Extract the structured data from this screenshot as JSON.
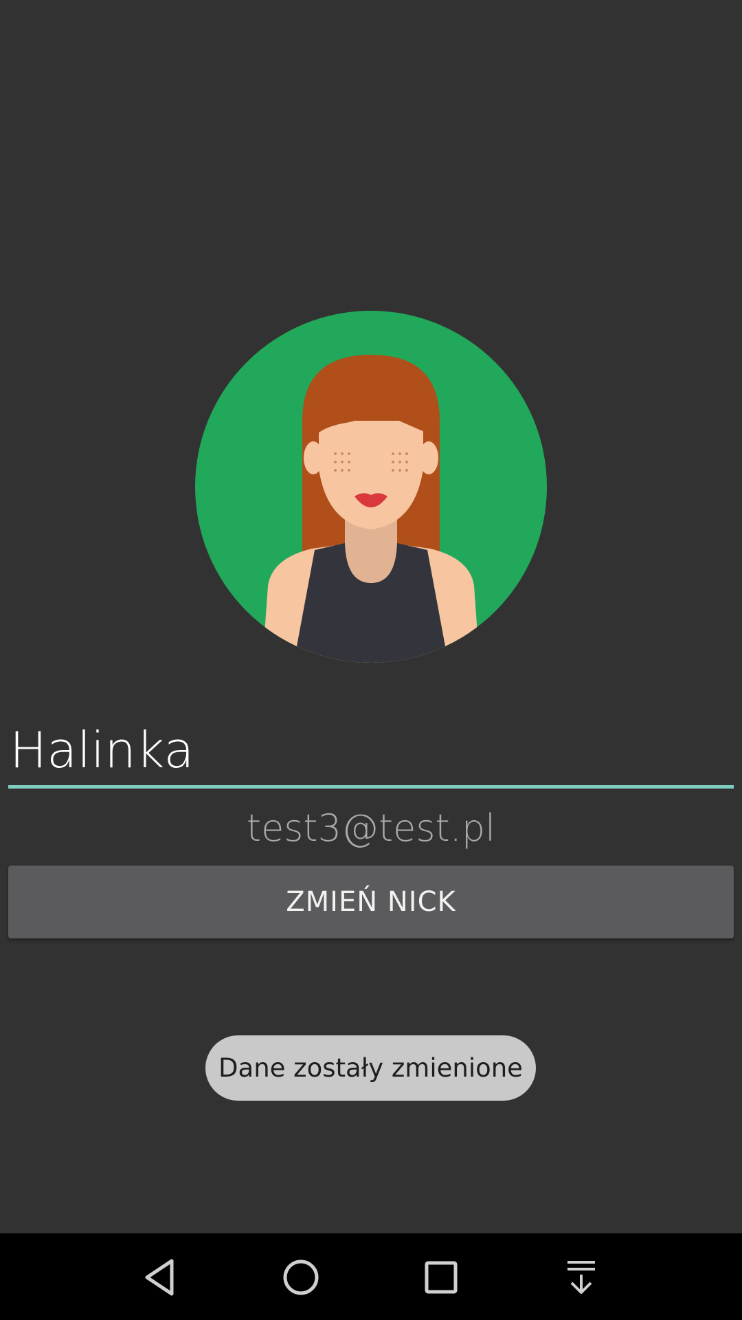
{
  "profile": {
    "avatar_icon": "female-avatar-icon",
    "nick": "Halinka",
    "email": "test3@test.pl"
  },
  "actions": {
    "change_nick_label": "ZMIEŃ NICK"
  },
  "toast": {
    "message": "Dane zostały zmienione"
  },
  "navbar": {
    "back_icon": "back-triangle-icon",
    "home_icon": "home-circle-icon",
    "recents_icon": "recents-square-icon",
    "notifications_icon": "pull-down-notifications-icon"
  },
  "colors": {
    "background": "#323232",
    "accent_underline": "#7fcdbf",
    "button": "#5b5b5d",
    "toast": "#c9c9c9",
    "avatar_bg": "#22a85a"
  }
}
